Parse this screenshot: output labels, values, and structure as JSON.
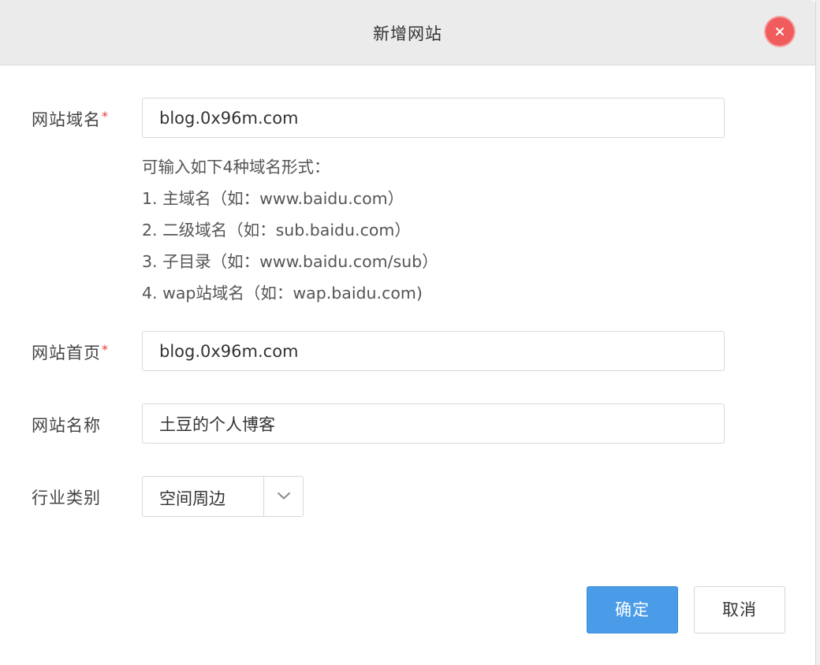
{
  "dialog": {
    "title": "新增网站",
    "close_icon": "close-icon"
  },
  "form": {
    "domain": {
      "label": "网站域名",
      "required_mark": "*",
      "value": "blog.0x96m.com"
    },
    "domain_hint": [
      "可输入如下4种域名形式：",
      "1. 主域名（如：www.baidu.com）",
      "2. 二级域名（如：sub.baidu.com）",
      "3. 子目录（如：www.baidu.com/sub）",
      "4. wap站域名（如：wap.baidu.com)"
    ],
    "homepage": {
      "label": "网站首页",
      "required_mark": "*",
      "value": "blog.0x96m.com"
    },
    "site_name": {
      "label": "网站名称",
      "value": "土豆的个人博客"
    },
    "industry": {
      "label": "行业类别",
      "selected": "空间周边",
      "arrow_icon": "chevron-down-icon"
    }
  },
  "buttons": {
    "confirm": "确定",
    "cancel": "取消"
  },
  "colors": {
    "primary": "#4a9be8",
    "close": "#f05b5b",
    "required": "#e53935"
  }
}
